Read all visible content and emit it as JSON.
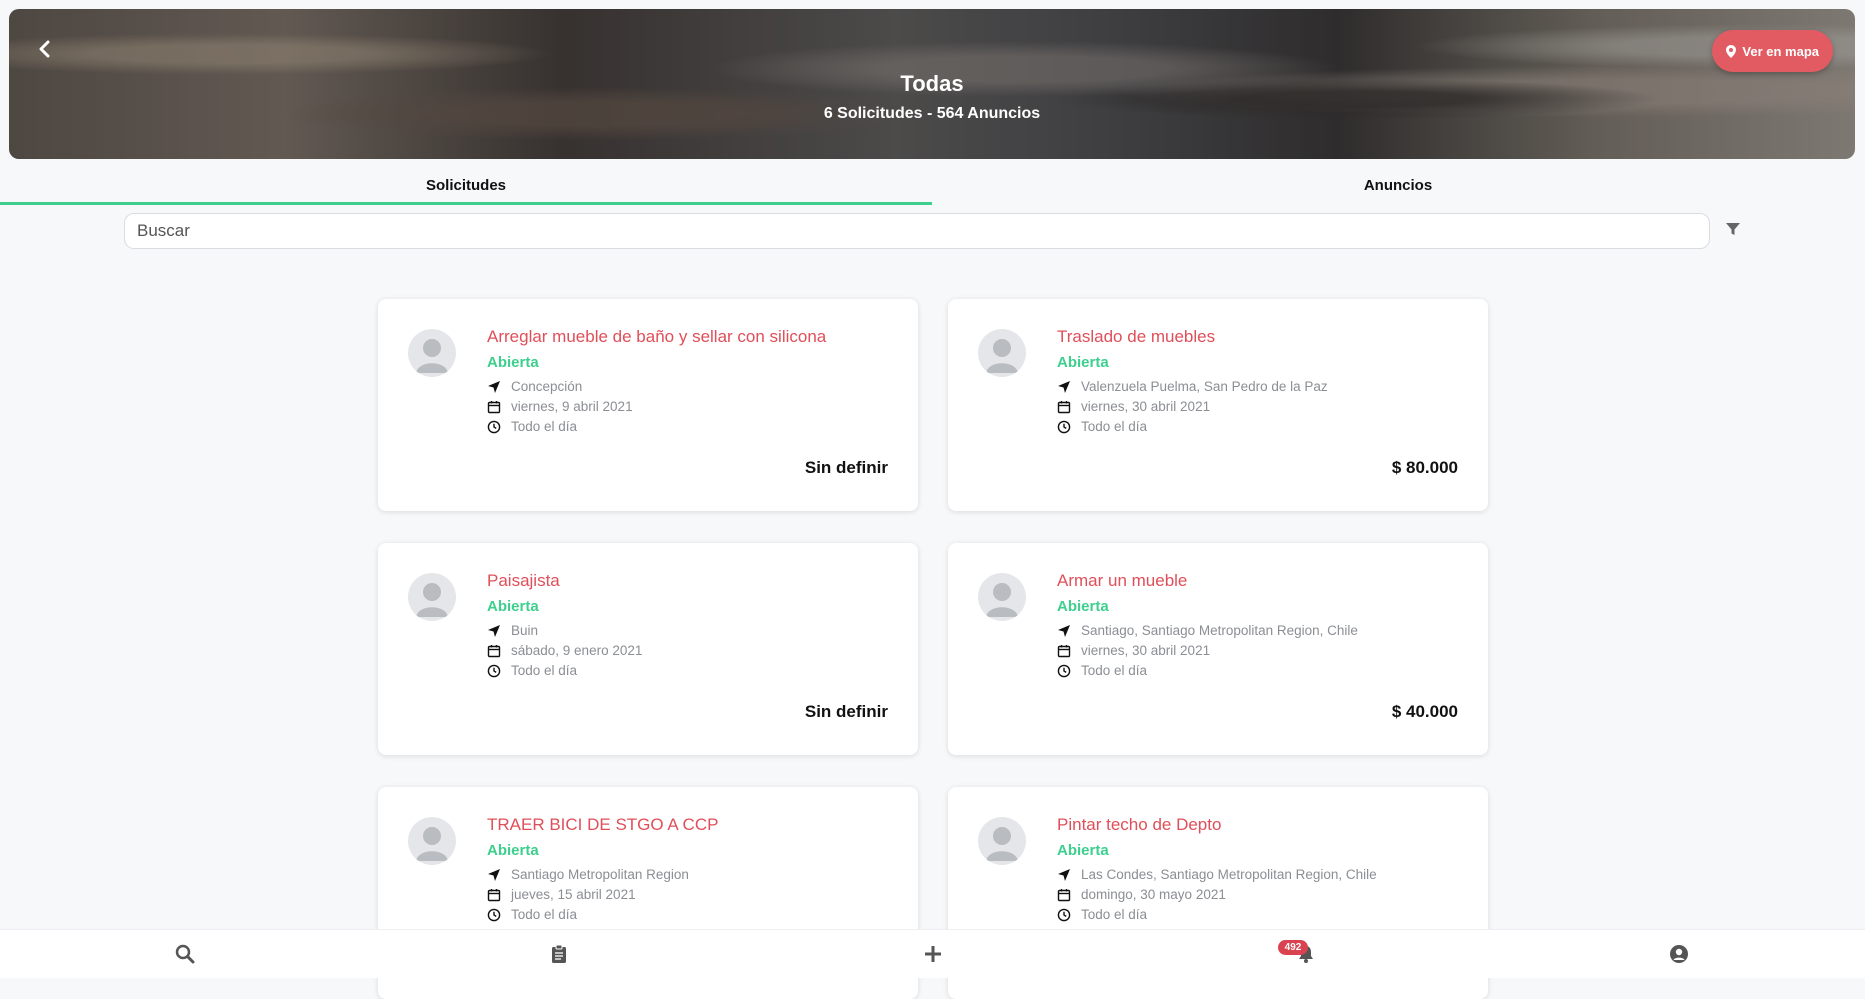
{
  "header": {
    "title": "Todas",
    "subtitle": "6 Solicitudes - 564 Anuncios",
    "map_button": "Ver en mapa"
  },
  "tabs": [
    {
      "label": "Solicitudes",
      "active": true
    },
    {
      "label": "Anuncios",
      "active": false
    }
  ],
  "search": {
    "placeholder": "Buscar",
    "value": ""
  },
  "cards": [
    {
      "title": "Arreglar mueble de baño y sellar con silicona",
      "status": "Abierta",
      "location": "Concepción",
      "date": "viernes, 9 abril 2021",
      "time": "Todo el día",
      "price": "Sin definir"
    },
    {
      "title": "Traslado de muebles",
      "status": "Abierta",
      "location": "Valenzuela Puelma, San Pedro de la Paz",
      "date": "viernes, 30 abril 2021",
      "time": "Todo el día",
      "price": "$ 80.000"
    },
    {
      "title": "Paisajista",
      "status": "Abierta",
      "location": "Buin",
      "date": "sábado, 9 enero 2021",
      "time": "Todo el día",
      "price": "Sin definir"
    },
    {
      "title": "Armar un mueble",
      "status": "Abierta",
      "location": "Santiago, Santiago Metropolitan Region, Chile",
      "date": "viernes, 30 abril 2021",
      "time": "Todo el día",
      "price": "$ 40.000"
    },
    {
      "title": "TRAER BICI DE STGO A CCP",
      "status": "Abierta",
      "location": "Santiago Metropolitan Region",
      "date": "jueves, 15 abril 2021",
      "time": "Todo el día",
      "price": ""
    },
    {
      "title": "Pintar techo de Depto",
      "status": "Abierta",
      "location": "Las Condes, Santiago Metropolitan Region, Chile",
      "date": "domingo, 30 mayo 2021",
      "time": "Todo el día",
      "price": ""
    }
  ],
  "bottom_nav": {
    "items": [
      "search-icon",
      "clipboard-icon",
      "plus-icon",
      "bell-icon",
      "user-icon"
    ],
    "notifications_count": "492"
  },
  "colors": {
    "accent_red": "#e04f59",
    "status_green": "#3ecf8e",
    "map_button": "#e25a62"
  }
}
